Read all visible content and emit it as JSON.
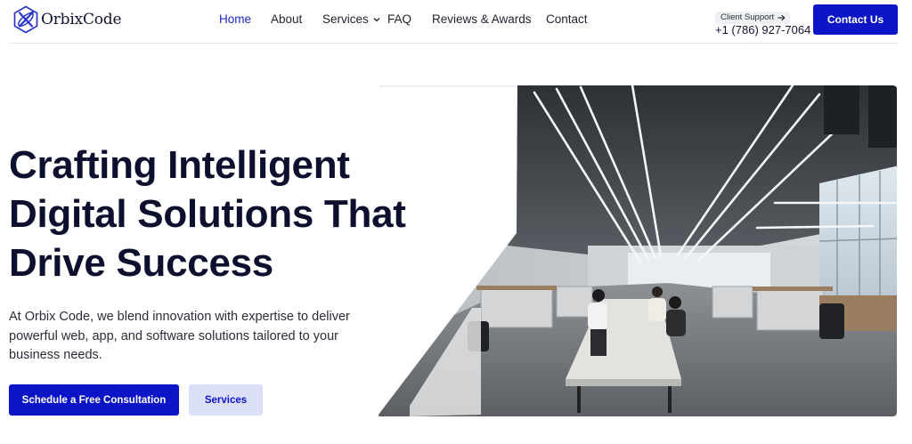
{
  "header": {
    "logo_text": "OrbixCode",
    "nav": [
      {
        "label": "Home",
        "active": true
      },
      {
        "label": "About",
        "active": false
      },
      {
        "label": "Services",
        "active": false,
        "has_dropdown": true
      },
      {
        "label": "FAQ",
        "active": false
      },
      {
        "label": "Reviews & Awards",
        "active": false
      },
      {
        "label": "Contact",
        "active": false
      }
    ],
    "support_label": "Client Support",
    "phone": "+1 (786) 927-7064",
    "contact_button": "Contact Us"
  },
  "hero": {
    "title_lines": [
      "Crafting Intelligent",
      "Digital Solutions That",
      "Drive Success"
    ],
    "description": "At Orbix Code, we blend innovation with expertise to deliver powerful web, app, and software solutions tailored to your business needs.",
    "primary_button": "Schedule a Free Consultation",
    "secondary_button": "Services",
    "image_subject": "modern open-plan office photo"
  },
  "colors": {
    "brand_blue": "#0c14c8",
    "active_nav": "#1c27c9",
    "heading": "#0d0f2e",
    "secondary_button_bg": "#dcdff8",
    "support_badge_bg": "#eef0f3"
  },
  "icons": {
    "logo": "orbix-logo-icon",
    "services_dropdown": "chevron-down-icon",
    "support_arrow": "arrow-right-icon"
  }
}
